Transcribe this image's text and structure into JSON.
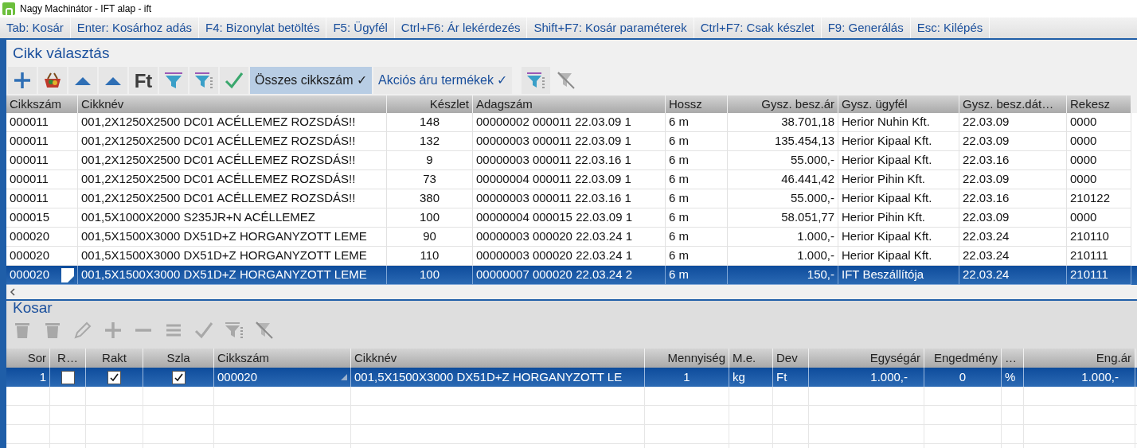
{
  "window": {
    "title": "Nagy Machinátor - IFT alap - ift"
  },
  "shortcuts": [
    {
      "key": "Tab:",
      "label": "Kosár"
    },
    {
      "key": "Enter:",
      "label": "Kosárhoz adás"
    },
    {
      "key": "F4:",
      "label": "Bizonylat betöltés"
    },
    {
      "key": "F5:",
      "label": "Ügyfél"
    },
    {
      "key": "Ctrl+F6:",
      "label": "Ár lekérdezés"
    },
    {
      "key": "Shift+F7:",
      "label": "Kosár paraméterek"
    },
    {
      "key": "Ctrl+F7:",
      "label": "Csak készlet"
    },
    {
      "key": "F9:",
      "label": "Generálás"
    },
    {
      "key": "Esc:",
      "label": "Kilépés"
    }
  ],
  "selection": {
    "title": "Cikk választás",
    "toolbar": [
      {
        "kind": "plus",
        "disabled": false
      },
      {
        "kind": "basket",
        "disabled": false
      },
      {
        "kind": "up",
        "disabled": false
      },
      {
        "kind": "up",
        "disabled": false
      },
      {
        "kind": "text",
        "label": "Ft",
        "disabled": false
      },
      {
        "kind": "filter",
        "disabled": false
      },
      {
        "kind": "filter-bars",
        "disabled": false
      },
      {
        "kind": "check",
        "disabled": false
      },
      {
        "kind": "toggle",
        "label": "Összes cikkszám ✓",
        "selected": true
      },
      {
        "kind": "toggle",
        "label": "Akciós áru termékek ✓",
        "selected": false
      },
      {
        "kind": "filter-bars",
        "disabled": false
      },
      {
        "kind": "filter-off",
        "disabled": true
      }
    ],
    "columns": [
      "Cikkszám",
      "Cikknév",
      "Készlet",
      "Adagszám",
      "Hossz",
      "Gysz. besz.ár",
      "Gysz. ügyfél",
      "Gysz. besz.dát…",
      "Rekesz"
    ],
    "rows": [
      {
        "selected": false,
        "cells": [
          "000011",
          "001,2X1250X2500 DC01 ACÉLLEMEZ ROZSDÁS!!",
          "148",
          "00000002 000011 22.03.09 1",
          "6 m",
          "38.701,18",
          "Herior Nuhin Kft.",
          "22.03.09",
          "0000"
        ]
      },
      {
        "selected": false,
        "cells": [
          "000011",
          "001,2X1250X2500 DC01 ACÉLLEMEZ ROZSDÁS!!",
          "132",
          "00000003 000011 22.03.09 1",
          "6 m",
          "135.454,13",
          "Herior Kipaal Kft.",
          "22.03.09",
          "0000"
        ]
      },
      {
        "selected": false,
        "cells": [
          "000011",
          "001,2X1250X2500 DC01 ACÉLLEMEZ ROZSDÁS!!",
          "9",
          "00000003 000011 22.03.16 1",
          "6 m",
          "55.000,-",
          "Herior Kipaal Kft.",
          "22.03.16",
          "0000"
        ]
      },
      {
        "selected": false,
        "cells": [
          "000011",
          "001,2X1250X2500 DC01 ACÉLLEMEZ ROZSDÁS!!",
          "73",
          "00000004 000011 22.03.09 1",
          "6 m",
          "46.441,42",
          "Herior Pihin Kft.",
          "22.03.09",
          "0000"
        ]
      },
      {
        "selected": false,
        "cells": [
          "000011",
          "001,2X1250X2500 DC01 ACÉLLEMEZ ROZSDÁS!!",
          "380",
          "00000003 000011 22.03.16 1",
          "6 m",
          "55.000,-",
          "Herior Kipaal Kft.",
          "22.03.16",
          "210122"
        ]
      },
      {
        "selected": false,
        "cells": [
          "000015",
          "001,5X1000X2000 S235JR+N ACÉLLEMEZ",
          "100",
          "00000004 000015 22.03.09 1",
          "6 m",
          "58.051,77",
          "Herior Pihin Kft.",
          "22.03.09",
          "0000"
        ]
      },
      {
        "selected": false,
        "cells": [
          "000020",
          "001,5X1500X3000 DX51D+Z HORGANYZOTT LEME",
          "90",
          "00000003 000020 22.03.24 1",
          "6 m",
          "1.000,-",
          "Herior Kipaal Kft.",
          "22.03.24",
          "210110"
        ]
      },
      {
        "selected": false,
        "cells": [
          "000020",
          "001,5X1500X3000 DX51D+Z HORGANYZOTT LEME",
          "110",
          "00000003 000020 22.03.24 1",
          "6 m",
          "1.000,-",
          "Herior Kipaal Kft.",
          "22.03.24",
          "210111"
        ]
      },
      {
        "selected": true,
        "cells": [
          "000020",
          "001,5X1500X3000 DX51D+Z HORGANYZOTT LEME",
          "100",
          "00000007 000020 22.03.24 2",
          "6 m",
          "150,-",
          "IFT Beszállítója",
          "22.03.24",
          "210111"
        ]
      }
    ]
  },
  "basket": {
    "title": "Kosar",
    "toolbar": [
      {
        "kind": "trash",
        "disabled": true
      },
      {
        "kind": "trash-a",
        "disabled": true
      },
      {
        "kind": "pencil",
        "disabled": true
      },
      {
        "kind": "plus",
        "disabled": true
      },
      {
        "kind": "minus",
        "disabled": true
      },
      {
        "kind": "lines",
        "disabled": true
      },
      {
        "kind": "check",
        "disabled": true
      },
      {
        "kind": "filter-bars",
        "disabled": true
      },
      {
        "kind": "filter-off",
        "disabled": true
      }
    ],
    "columns": [
      "Sor",
      "R…",
      "Rakt",
      "Szla",
      "Cikkszám",
      "Cikknév",
      "Mennyiség",
      "M.e.",
      "Dev",
      "Egységár",
      "Engedmény",
      "…",
      "Eng.ár"
    ],
    "rows": [
      {
        "selected": true,
        "sor": "1",
        "r": false,
        "rakt": true,
        "szla": true,
        "cikkszam": "000020",
        "cikknev": "001,5X1500X3000 DX51D+Z HORGANYZOTT LE",
        "mennyiseg": "1",
        "me": "kg",
        "dev": "Ft",
        "egysegar": "1.000,-",
        "engedmeny": "0",
        "unit": "%",
        "engar": "1.000,-"
      }
    ]
  }
}
